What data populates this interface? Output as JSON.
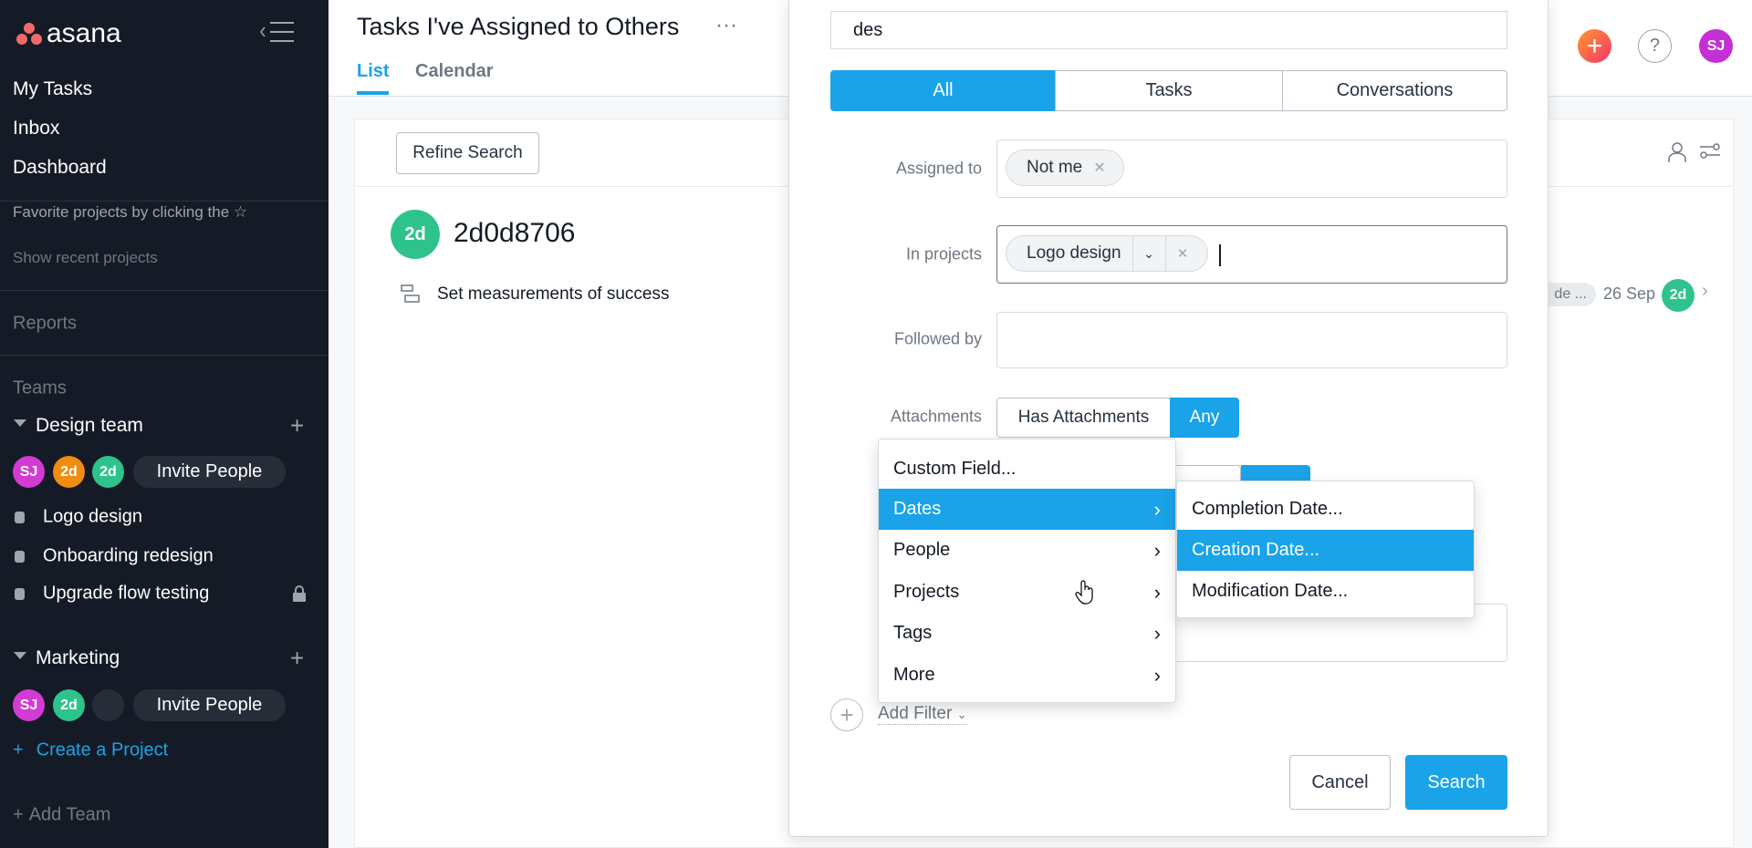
{
  "colors": {
    "accent": "#1aa3e8",
    "sidebar_bg": "#151b26"
  },
  "sidebar": {
    "logo": "asana",
    "nav": [
      {
        "label": "My Tasks"
      },
      {
        "label": "Inbox"
      },
      {
        "label": "Dashboard"
      }
    ],
    "favorites_hint": "Favorite projects by clicking the",
    "show_recent": "Show recent projects",
    "reports": "Reports",
    "teams_heading": "Teams",
    "teams": [
      {
        "name": "Design team",
        "members": [
          "SJ",
          "2d",
          "2d"
        ],
        "invite": "Invite People",
        "projects": [
          "Logo design",
          "Onboarding redesign",
          "Upgrade flow testing"
        ]
      },
      {
        "name": "Marketing",
        "members": [
          "SJ",
          "2d",
          ""
        ],
        "invite": "Invite People"
      }
    ],
    "create_project": "Create a Project",
    "add_team": "Add Team"
  },
  "header": {
    "title": "Tasks I've Assigned to Others",
    "more": "···",
    "tabs": [
      {
        "label": "List",
        "active": true
      },
      {
        "label": "Calendar"
      }
    ],
    "user_initials": "SJ",
    "help": "?"
  },
  "main": {
    "refine_search": "Refine Search",
    "group": {
      "avatar": "2d",
      "name": "2d0d8706"
    },
    "task": {
      "name": "Set measurements of success",
      "tag": "de ...",
      "due": "26 Sep",
      "assignee": "2d"
    }
  },
  "search": {
    "query": "des",
    "scope": [
      "All",
      "Tasks",
      "Conversations"
    ],
    "scope_selected": "All",
    "assigned_to_label": "Assigned to",
    "assigned_to_chip": "Not me",
    "in_projects_label": "In projects",
    "in_projects_chip": "Logo design",
    "followed_by_label": "Followed by",
    "attachments_label": "Attachments",
    "attachments_options": [
      "Has Attachments",
      "Any"
    ],
    "attachments_selected": "Any",
    "add_filter": "Add Filter",
    "cancel": "Cancel",
    "submit": "Search"
  },
  "filter_menu": {
    "items": [
      "Custom Field...",
      "Dates",
      "People",
      "Projects",
      "Tags",
      "More"
    ],
    "highlighted": "Dates"
  },
  "dates_submenu": {
    "items": [
      "Completion Date...",
      "Creation Date...",
      "Modification Date..."
    ],
    "highlighted": "Creation Date..."
  }
}
